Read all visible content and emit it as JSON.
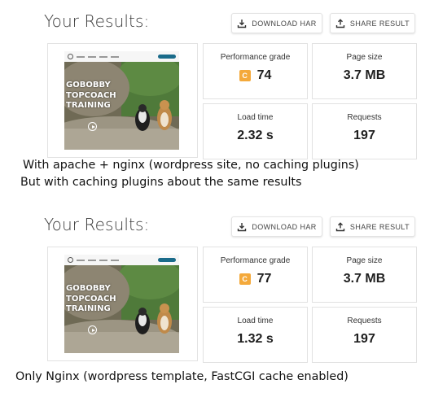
{
  "results": [
    {
      "heading": "Your Results:",
      "download_label": "DOWNLOAD HAR",
      "share_label": "SHARE RESULT",
      "screenshot_title_lines": [
        "GOBOBBY",
        "TOPCOACH",
        "TRAINING"
      ],
      "performance": {
        "label": "Performance grade",
        "grade": "C",
        "score": "74",
        "grade_color": "#f4a93b"
      },
      "page_size": {
        "label": "Page size",
        "value": "3.7 MB"
      },
      "load_time": {
        "label": "Load time",
        "value": "2.32 s"
      },
      "requests": {
        "label": "Requests",
        "value": "197"
      }
    },
    {
      "heading": "Your Results:",
      "download_label": "DOWNLOAD HAR",
      "share_label": "SHARE RESULT",
      "screenshot_title_lines": [
        "GOBOBBY",
        "TOPCOACH",
        "TRAINING"
      ],
      "performance": {
        "label": "Performance grade",
        "grade": "C",
        "score": "77",
        "grade_color": "#f4a93b"
      },
      "page_size": {
        "label": "Page size",
        "value": "3.7 MB"
      },
      "load_time": {
        "label": "Load time",
        "value": "1.32 s"
      },
      "requests": {
        "label": "Requests",
        "value": "197"
      }
    }
  ],
  "captions": {
    "first_line1": "With apache + nginx (wordpress site, no caching plugins)",
    "first_line2": "But with caching plugins about the same results",
    "second": "Only Nginx (wordpress template, FastCGI cache enabled)"
  },
  "icons": {
    "download": "download-icon",
    "share": "share-icon",
    "play": "play-icon"
  }
}
